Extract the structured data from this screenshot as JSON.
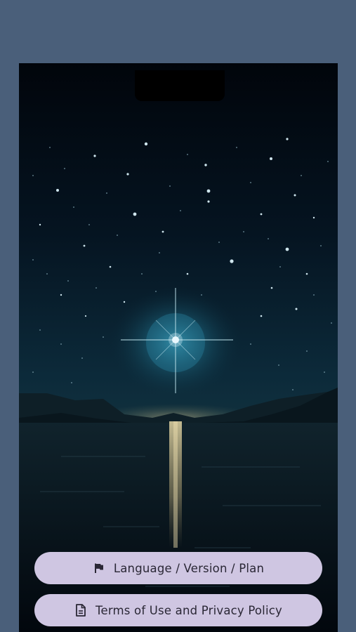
{
  "background_color": "#4a5f7a",
  "button_color": "#cfc6e2",
  "buttons": {
    "language": {
      "label": "Language / Version / Plan",
      "icon": "flag-icon"
    },
    "terms": {
      "label": "Terms of Use and Privacy Policy",
      "icon": "document-icon"
    }
  }
}
